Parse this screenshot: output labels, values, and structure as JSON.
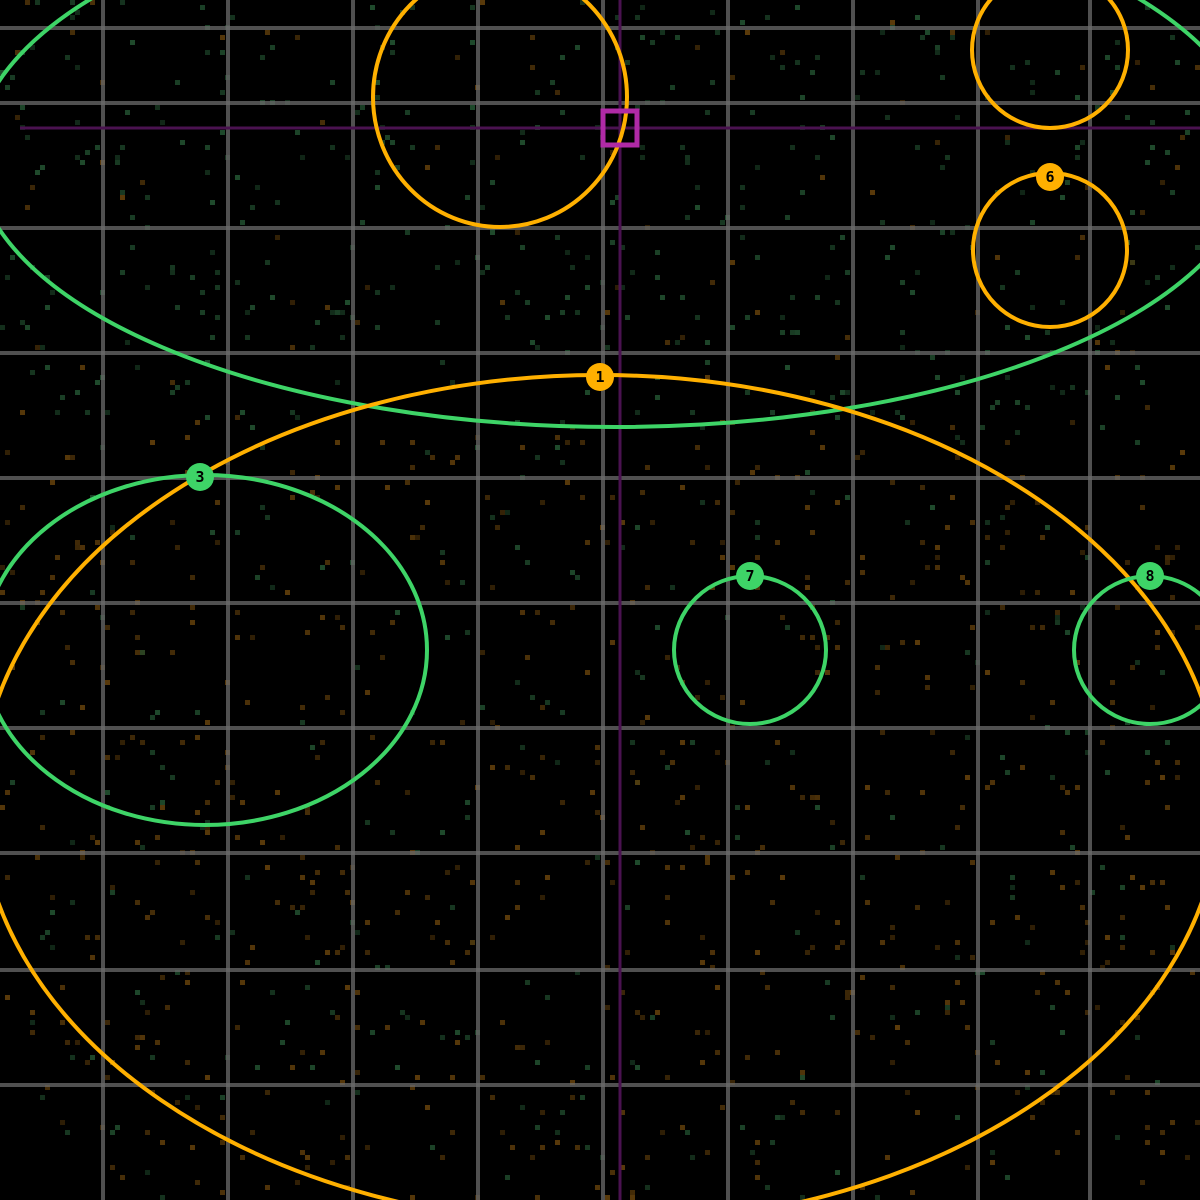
{
  "colors": {
    "background": "#000000",
    "grid": "#6b6b6b",
    "ring_orange": "#ffb000",
    "ring_green": "#3ed467",
    "cursor": "#b02aa6",
    "cursor_line": "#4a1250",
    "speckle_green": "#1f4a2c",
    "speckle_orange": "#5a3a0a"
  },
  "rings": [
    {
      "id": "A",
      "label": "",
      "color": "green"
    },
    {
      "id": "B",
      "label": "",
      "color": "orange"
    },
    {
      "id": "C",
      "label": "",
      "color": "orange"
    },
    {
      "id": "1",
      "label": "1",
      "color": "orange"
    },
    {
      "id": "3",
      "label": "3",
      "color": "green"
    },
    {
      "id": "6",
      "label": "6",
      "color": "orange"
    },
    {
      "id": "7",
      "label": "7",
      "color": "green"
    },
    {
      "id": "8",
      "label": "8",
      "color": "green"
    }
  ],
  "cursor": {
    "name": "selection-cursor"
  }
}
